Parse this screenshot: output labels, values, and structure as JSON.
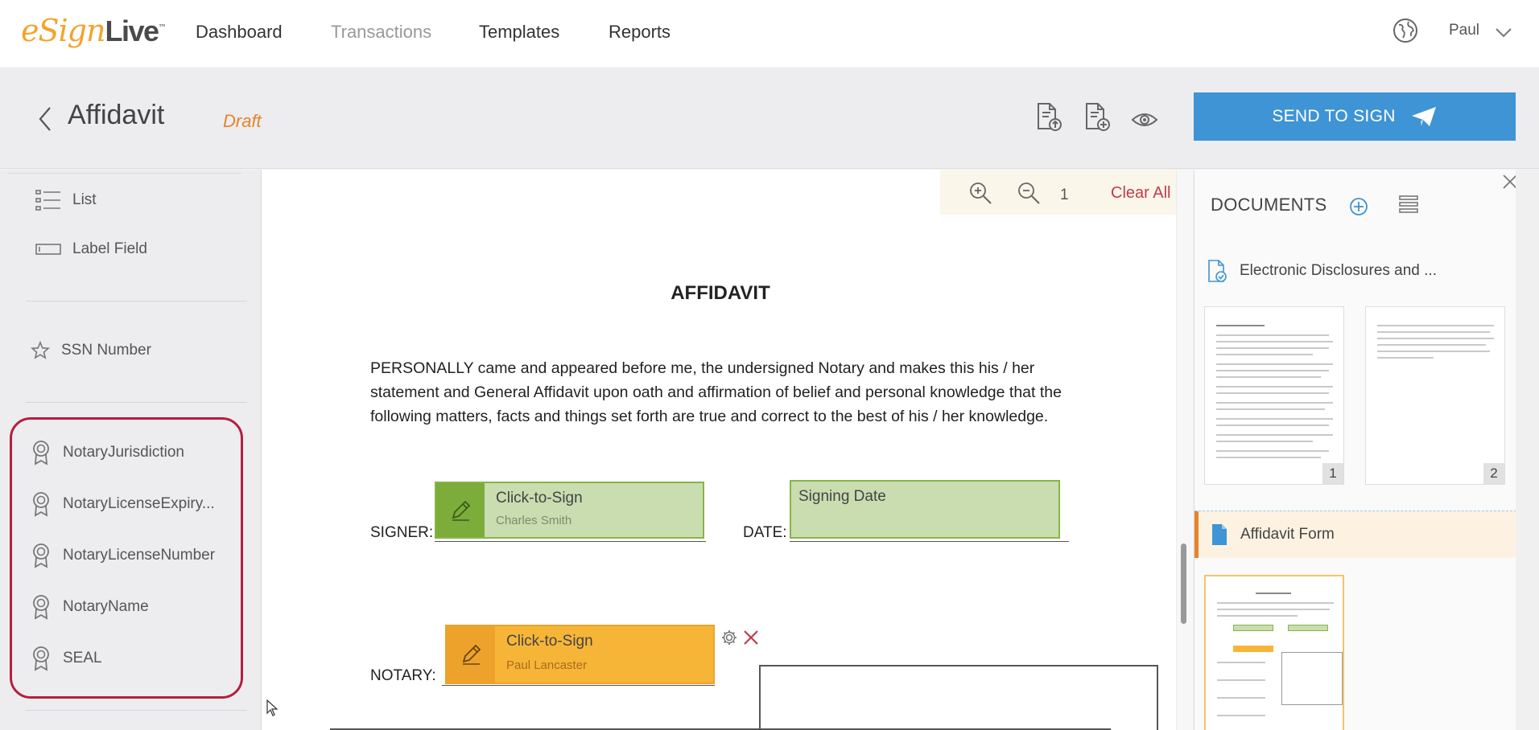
{
  "app": {
    "logo": {
      "e": "e",
      "sign": "Sign",
      "live": "Live",
      "tm": "™"
    },
    "nav": [
      "Dashboard",
      "Transactions",
      "Templates",
      "Reports"
    ],
    "user": "Paul"
  },
  "header": {
    "title": "Affidavit",
    "status": "Draft",
    "send_label": "SEND TO SIGN"
  },
  "left_panel": {
    "fields": [
      {
        "label": "List",
        "icon": "list-icon"
      },
      {
        "label": "Label Field",
        "icon": "label-field-icon"
      },
      {
        "label": "SSN Number",
        "icon": "star-icon"
      }
    ],
    "notary_fields": [
      {
        "label": "NotaryJurisdiction",
        "icon": "ribbon-icon"
      },
      {
        "label": "NotaryLicenseExpiry...",
        "icon": "ribbon-icon"
      },
      {
        "label": "NotaryLicenseNumber",
        "icon": "ribbon-icon"
      },
      {
        "label": "NotaryName",
        "icon": "ribbon-icon"
      },
      {
        "label": "SEAL",
        "icon": "ribbon-icon"
      }
    ]
  },
  "document": {
    "zoom": {
      "page": "1",
      "clear_all": "Clear All"
    },
    "title": "AFFIDAVIT",
    "paragraph": "PERSONALLY came and appeared before me, the undersigned Notary and makes this his / her statement and General Affidavit upon oath and affirmation of belief and personal knowledge that the following matters, facts and things set forth are true and correct to the best of his / her knowledge.",
    "signer_label": "SIGNER:",
    "date_label": "DATE:",
    "notary_label": "NOTARY:",
    "signer_field": {
      "label": "Click-to-Sign",
      "name": "Charles Smith"
    },
    "date_field": {
      "label": "Signing Date"
    },
    "notary_field": {
      "label": "Click-to-Sign",
      "name": "Paul Lancaster"
    }
  },
  "right_panel": {
    "heading": "DOCUMENTS",
    "documents": [
      {
        "name": "Electronic Disclosures and ...",
        "pages": [
          "1",
          "2"
        ]
      },
      {
        "name": "Affidavit Form",
        "pages": []
      }
    ]
  },
  "colors": {
    "accent_blue": "#3e94d4",
    "draft_orange": "#e8832a",
    "signer_green": "#c9ddb0",
    "notary_orange": "#f7b538",
    "highlight_red": "#b51f3e"
  }
}
